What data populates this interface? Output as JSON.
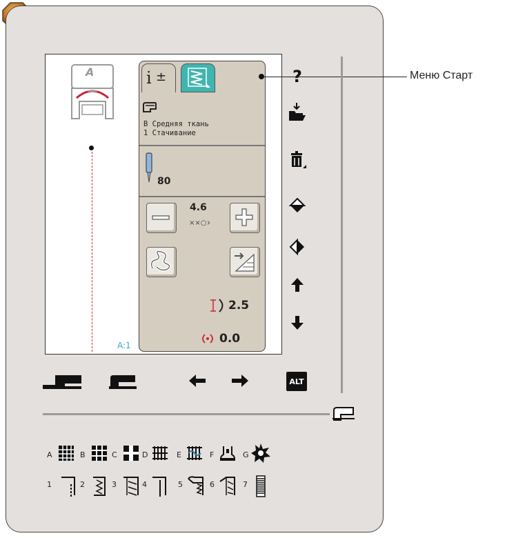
{
  "callout": {
    "label": "Меню Старт"
  },
  "foot_letter": "A",
  "fabric": {
    "line1": "В Средняя ткань",
    "line2": "1 Стачивание"
  },
  "needle": {
    "size": "80"
  },
  "stitch_width": {
    "value": "4.6"
  },
  "stitch_length": {
    "value": "2.5"
  },
  "balance": {
    "value": "0.0"
  },
  "pattern": {
    "label": "A:1"
  },
  "right_icons": {
    "help": "?"
  },
  "alt_button": {
    "label": "ALT"
  },
  "categories": [
    "A",
    "B",
    "C",
    "D",
    "E",
    "F",
    "G"
  ],
  "menus": [
    "1",
    "2",
    "3",
    "4",
    "5",
    "6",
    "7"
  ],
  "colors": {
    "accent": "#40b5b0",
    "panel": "#e3e0dd",
    "ctrl": "#d5cdbf",
    "stitch": "#cc2233",
    "start": "#c8761f"
  }
}
